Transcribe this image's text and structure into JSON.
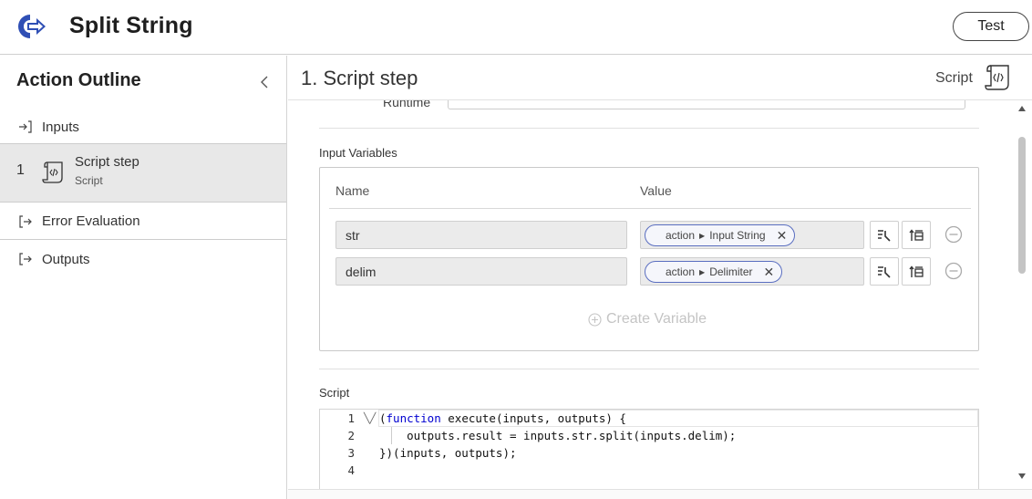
{
  "header": {
    "title": "Split String",
    "test_label": "Test",
    "accent": "#2f4fb5"
  },
  "sidebar": {
    "title": "Action Outline",
    "items": [
      {
        "label": "Inputs"
      },
      {
        "number": "1",
        "label": "Script step",
        "sublabel": "Script"
      },
      {
        "label": "Error Evaluation"
      },
      {
        "label": "Outputs"
      }
    ]
  },
  "main": {
    "step_title": "1.  Script step",
    "step_type": "Script",
    "runtime_label": "Runtime",
    "input_variables": {
      "label": "Input Variables",
      "col_name": "Name",
      "col_value": "Value",
      "rows": [
        {
          "name": "str",
          "pill_prefix": "action",
          "pill_value": "Input String"
        },
        {
          "name": "delim",
          "pill_prefix": "action",
          "pill_value": "Delimiter"
        }
      ],
      "create_label": "Create Variable"
    },
    "script": {
      "label": "Script",
      "lines": [
        {
          "num": "1",
          "kw": "function",
          "pre": "(",
          "post": " execute(inputs, outputs) {"
        },
        {
          "num": "2",
          "text": "    outputs.result = inputs.str.split(inputs.delim);"
        },
        {
          "num": "3",
          "text": "})(inputs, outputs);"
        },
        {
          "num": "4",
          "text": ""
        }
      ]
    }
  }
}
